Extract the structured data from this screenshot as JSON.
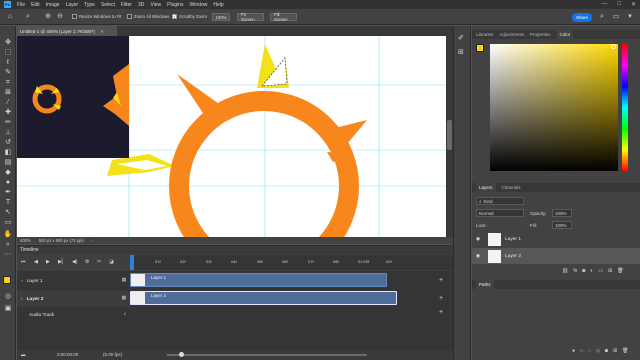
{
  "app": {
    "logo": "Ps"
  },
  "menu": [
    "File",
    "Edit",
    "Image",
    "Layer",
    "Type",
    "Select",
    "Filter",
    "3D",
    "View",
    "Plugins",
    "Window",
    "Help"
  ],
  "window_controls": {
    "minimize": "—",
    "maximize": "□",
    "close": "✕"
  },
  "options_bar": {
    "resize_windows_label": "Resize Windows to Fit",
    "zoom_all_label": "Zoom All Windows",
    "scrubby_zoom_label": "Scrubby Zoom",
    "zoom_value": "100%",
    "fit_screen_label": "Fit Screen",
    "fill_screen_label": "Fill Screen",
    "share_label": "Share"
  },
  "document": {
    "tab_title": "Untitled-1 @ 400% (Layer 2, RGB/8*)",
    "close_glyph": "×",
    "zoom_status": "400%",
    "size_status": "500 px x 500 px (72 ppi)"
  },
  "timeline": {
    "title": "Timeline",
    "ticks": [
      "01f",
      "02f",
      "03f",
      "04f",
      "05f",
      "06f",
      "07f",
      "08f",
      "01:00f",
      "02f"
    ],
    "layers": [
      {
        "name": "Layer 1",
        "clip_label": "Layer 1"
      },
      {
        "name": "Layer 2",
        "clip_label": "Layer 2"
      }
    ],
    "audio_track": "Audio Track",
    "timecode": "0:00:00:00",
    "fps": "(5.00 fps)"
  },
  "panels": {
    "color_tabs": [
      "Libraries",
      "Adjustments",
      "Properties",
      "Color"
    ],
    "color_active": "Color",
    "layers_tabs": [
      "Layers",
      "Channels"
    ],
    "layers_active": "Layers",
    "kind_label": "Kind",
    "blend_mode": "Normal",
    "opacity_label": "Opacity:",
    "opacity_value": "100%",
    "lock_label": "Lock:",
    "fill_label": "Fill:",
    "fill_value": "100%",
    "layers": [
      {
        "name": "Layer 1",
        "selected": false
      },
      {
        "name": "Layer 2",
        "selected": true
      }
    ],
    "paths_tab": "Paths"
  },
  "colors": {
    "foreground": "#ffd21a",
    "background": "#ffffff",
    "accent": "#1473e6",
    "clip": "#4f6d9a",
    "orange": "#f7861c",
    "yellow": "#f2e21a"
  }
}
